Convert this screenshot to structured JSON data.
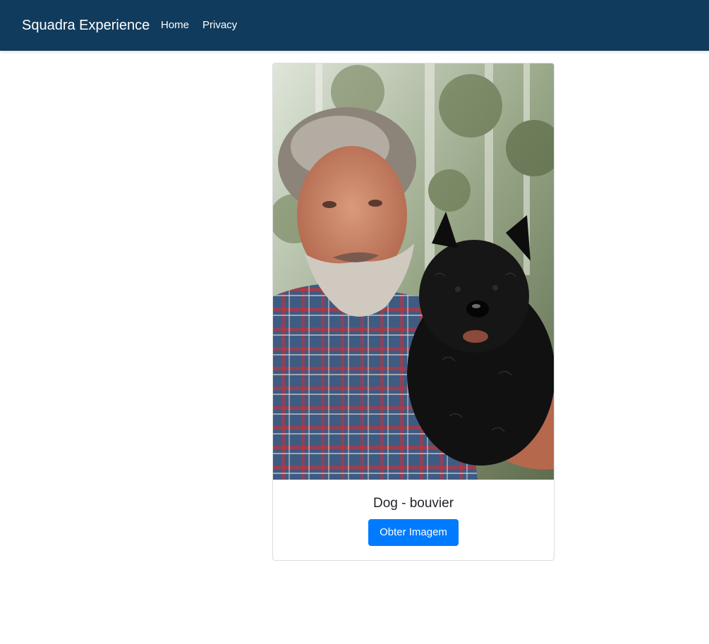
{
  "navbar": {
    "brand": "Squadra Experience",
    "links": [
      {
        "label": "Home"
      },
      {
        "label": "Privacy"
      }
    ],
    "background_color": "#113b5d"
  },
  "card": {
    "image": {
      "alt": "Dog - bouvier"
    },
    "title": "Dog - bouvier",
    "button_label": "Obter Imagem",
    "button_color": "#007bff"
  }
}
